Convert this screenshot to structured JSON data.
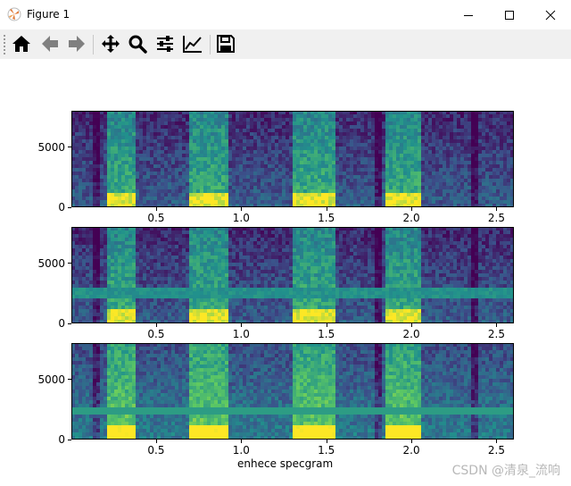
{
  "window": {
    "title": "Figure 1",
    "controls": [
      "minimize",
      "maximize",
      "close"
    ]
  },
  "toolbar": {
    "buttons": [
      {
        "name": "home",
        "icon": "home-icon"
      },
      {
        "name": "back",
        "icon": "back-arrow-icon"
      },
      {
        "name": "forward",
        "icon": "forward-arrow-icon"
      },
      {
        "name": "pan",
        "icon": "move-icon"
      },
      {
        "name": "zoom",
        "icon": "zoom-icon"
      },
      {
        "name": "configure-subplots",
        "icon": "sliders-icon"
      },
      {
        "name": "edit-axes",
        "icon": "line-chart-icon"
      },
      {
        "name": "save",
        "icon": "save-icon"
      }
    ]
  },
  "colors": {
    "viridis_low": "#440154",
    "viridis_mid": "#21918c",
    "viridis_high": "#fde725"
  },
  "chart_data": [
    {
      "type": "heatmap",
      "title": "",
      "xlabel": "",
      "ylabel": "",
      "xlim": [
        0.0,
        2.6
      ],
      "ylim": [
        0,
        8000
      ],
      "xticks": [
        "0.5",
        "1.0",
        "1.5",
        "2.0",
        "2.5"
      ],
      "yticks": [
        "0",
        "5000"
      ],
      "colormap": "viridis"
    },
    {
      "type": "heatmap",
      "title": "",
      "xlabel": "",
      "ylabel": "",
      "xlim": [
        0.0,
        2.6
      ],
      "ylim": [
        0,
        8000
      ],
      "xticks": [
        "0.5",
        "1.0",
        "1.5",
        "2.0",
        "2.5"
      ],
      "yticks": [
        "0",
        "5000"
      ],
      "colormap": "viridis"
    },
    {
      "type": "heatmap",
      "title": "",
      "xlabel": "enhece specgram",
      "ylabel": "",
      "xlim": [
        0.0,
        2.6
      ],
      "ylim": [
        0,
        8000
      ],
      "xticks": [
        "0.5",
        "1.0",
        "1.5",
        "2.0",
        "2.5"
      ],
      "yticks": [
        "0",
        "5000"
      ],
      "colormap": "viridis"
    }
  ],
  "watermark": "CSDN @清泉_流响"
}
